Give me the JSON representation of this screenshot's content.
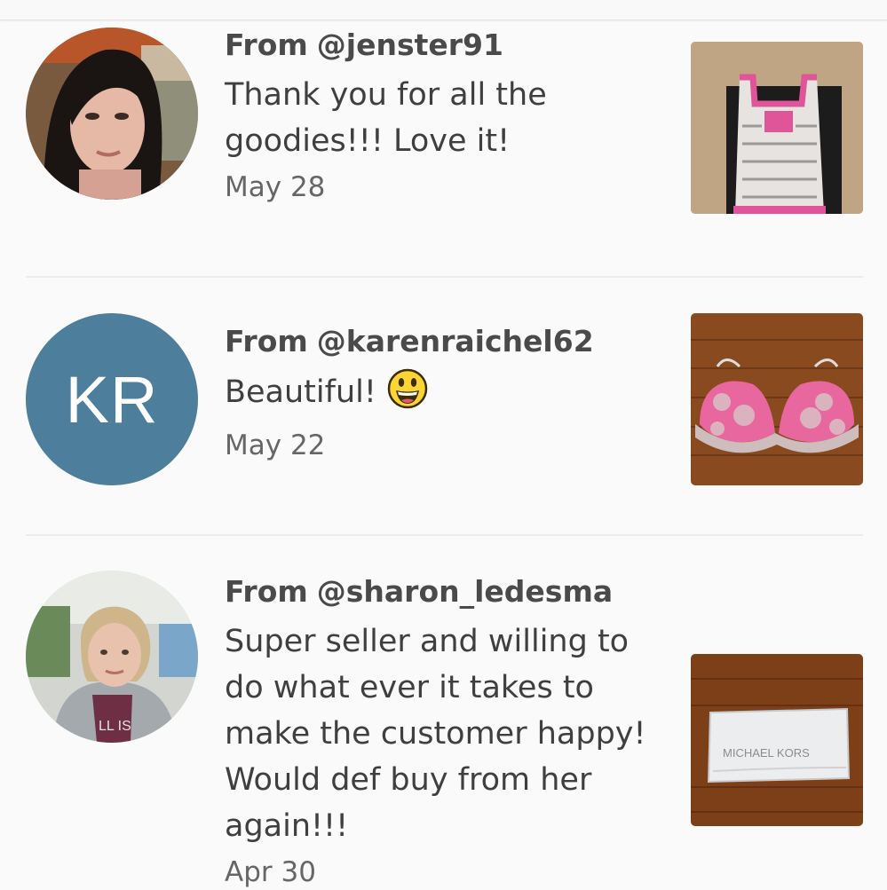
{
  "reviews": [
    {
      "from_prefix": "From",
      "username": "@jenster91",
      "message": "Thank you for all the goodies!!! Love it!",
      "date": "May 28",
      "avatar": "photo",
      "thumbnail": "pink-dc-tank-top"
    },
    {
      "from_prefix": "From",
      "username": "@karenraichel62",
      "message": "Beautiful!",
      "emoji": "grinning-face-emoji",
      "date": "May 22",
      "avatar_initials": "KR",
      "avatar_color": "#4d7f9c",
      "thumbnail": "pink-lace-bra"
    },
    {
      "from_prefix": "From",
      "username": "@sharon_ledesma",
      "message": "Super seller and willing to do what ever it takes to make the customer happy! Would def buy from her again!!!",
      "date": "Apr 30",
      "avatar": "photo",
      "thumbnail": "michael-kors-dust-bag",
      "thumbnail_text": "MICHAEL KORS"
    }
  ]
}
